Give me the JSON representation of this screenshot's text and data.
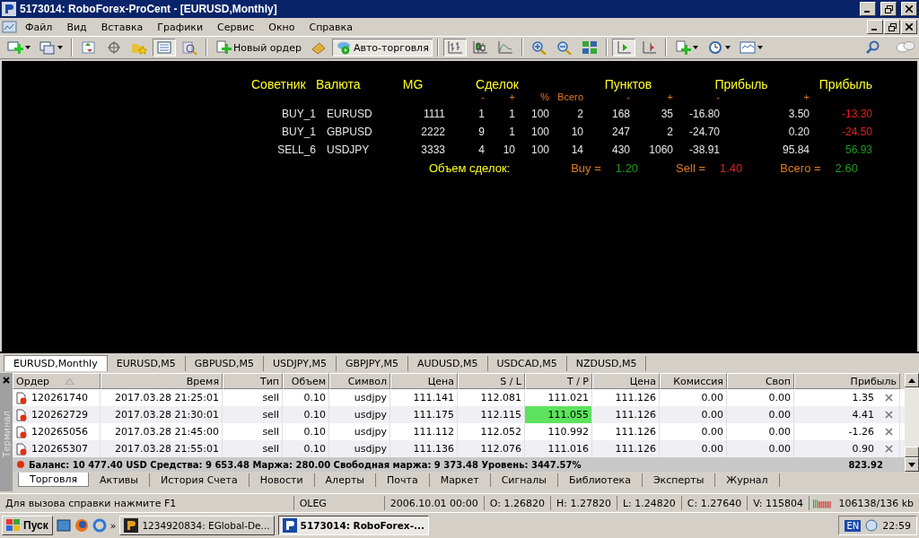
{
  "window": {
    "title": "5173014: RoboForex-ProCent - [EURUSD,Monthly]"
  },
  "menu": [
    "Файл",
    "Вид",
    "Вставка",
    "Графики",
    "Сервис",
    "Окно",
    "Справка"
  ],
  "toolbar": [
    {
      "selected": false
    },
    {
      "selected": false
    },
    {
      "selected": false
    },
    {
      "selected": false
    },
    {
      "selected": false
    },
    {
      "selected": true
    },
    {
      "selected": false
    },
    {
      "selected": false,
      "label": "Новый ордер"
    },
    {
      "selected": false
    },
    {
      "selected": true,
      "label": "Авто-торговля"
    },
    {
      "selected": true
    },
    {
      "selected": false
    },
    {
      "selected": false
    },
    {
      "selected": false
    },
    {
      "selected": false
    },
    {
      "selected": false
    },
    {
      "selected": true
    },
    {
      "selected": false
    },
    {
      "selected": false
    },
    {
      "selected": false
    },
    {
      "selected": false
    }
  ],
  "expert_panel": {
    "headers": [
      "Советник",
      "Валюта",
      "MG",
      "Сделок",
      "Пунктов",
      "Прибыль",
      "Прибыль"
    ],
    "subheaders": [
      "-",
      "+",
      "%",
      "Всего",
      "-",
      "+",
      "-",
      "+"
    ],
    "rows": [
      {
        "advisor": "BUY_1",
        "currency": "EURUSD",
        "mg": "1111",
        "deals_minus": "1",
        "deals_plus": "1",
        "deals_pct": "100",
        "deals_total": "2",
        "points_minus": "168",
        "points_plus": "35",
        "profit_minus": "-16.80",
        "profit_plus": "3.50",
        "profit": "-13.30",
        "color": "#e02020"
      },
      {
        "advisor": "BUY_1",
        "currency": "GBPUSD",
        "mg": "2222",
        "deals_minus": "9",
        "deals_plus": "1",
        "deals_pct": "100",
        "deals_total": "10",
        "points_minus": "247",
        "points_plus": "2",
        "profit_minus": "-24.70",
        "profit_plus": "0.20",
        "profit": "-24.50",
        "color": "#e02020"
      },
      {
        "advisor": "SELL_6",
        "currency": "USDJPY",
        "mg": "3333",
        "deals_minus": "4",
        "deals_plus": "10",
        "deals_pct": "100",
        "deals_total": "14",
        "points_minus": "430",
        "points_plus": "1060",
        "profit_minus": "-38.91",
        "profit_plus": "95.84",
        "profit": "56.93",
        "color": "#1f9a1f"
      }
    ],
    "summary": {
      "label": "Объем сделок:",
      "items": [
        {
          "label": "Buy =",
          "value": "1.20",
          "color": "#1f9a1f"
        },
        {
          "label": "Sell =",
          "value": "1.40",
          "color": "#e02020"
        },
        {
          "label": "Всего =",
          "value": "2.60",
          "color": "#1f9a1f"
        }
      ]
    }
  },
  "chart_tabs": [
    {
      "label": "EURUSD,Monthly",
      "selected": true
    },
    {
      "label": "EURUSD,M5",
      "selected": false
    },
    {
      "label": "GBPUSD,M5",
      "selected": false
    },
    {
      "label": "USDJPY,M5",
      "selected": false
    },
    {
      "label": "GBPJPY,M5",
      "selected": false
    },
    {
      "label": "AUDUSD,M5",
      "selected": false
    },
    {
      "label": "USDCAD,M5",
      "selected": false
    },
    {
      "label": "NZDUSD,M5",
      "selected": false
    }
  ],
  "terminal": {
    "label": "Терминал",
    "columns": [
      "Ордер",
      "Время",
      "Тип",
      "Объем",
      "Символ",
      "Цена",
      "S / L",
      "T / P",
      "Цена",
      "Комиссия",
      "Своп",
      "Прибыль"
    ],
    "rows": [
      {
        "order": "120261740",
        "time": "2017.03.28 21:25:01",
        "type": "sell",
        "volume": "0.10",
        "symbol": "usdjpy",
        "price": "111.141",
        "sl": "112.081",
        "tp": "111.021",
        "tp_hit": false,
        "current": "111.126",
        "commission": "0.00",
        "swap": "0.00",
        "profit": "1.35"
      },
      {
        "order": "120262729",
        "time": "2017.03.28 21:30:01",
        "type": "sell",
        "volume": "0.10",
        "symbol": "usdjpy",
        "price": "111.175",
        "sl": "112.115",
        "tp": "111.055",
        "tp_hit": true,
        "current": "111.126",
        "commission": "0.00",
        "swap": "0.00",
        "profit": "4.41"
      },
      {
        "order": "120265056",
        "time": "2017.03.28 21:45:00",
        "type": "sell",
        "volume": "0.10",
        "symbol": "usdjpy",
        "price": "111.112",
        "sl": "112.052",
        "tp": "110.992",
        "tp_hit": false,
        "current": "111.126",
        "commission": "0.00",
        "swap": "0.00",
        "profit": "-1.26"
      },
      {
        "order": "120265307",
        "time": "2017.03.28 21:55:01",
        "type": "sell",
        "volume": "0.10",
        "symbol": "usdjpy",
        "price": "111.136",
        "sl": "112.076",
        "tp": "111.016",
        "tp_hit": false,
        "current": "111.126",
        "commission": "0.00",
        "swap": "0.00",
        "profit": "0.90"
      }
    ],
    "balance": {
      "text": "Баланс: 10 477.40 USD  Средства: 9 653.48  Маржа: 280.00  Свободная маржа: 9 373.48  Уровень: 3447.57%",
      "profit": "823.92"
    },
    "tabs": [
      {
        "label": "Торговля",
        "selected": true
      },
      {
        "label": "Активы",
        "selected": false
      },
      {
        "label": "История Счета",
        "selected": false
      },
      {
        "label": "Новости",
        "selected": false
      },
      {
        "label": "Алерты",
        "selected": false
      },
      {
        "label": "Почта",
        "selected": false
      },
      {
        "label": "Маркет",
        "selected": false
      },
      {
        "label": "Сигналы",
        "selected": false
      },
      {
        "label": "Библиотека",
        "selected": false
      },
      {
        "label": "Эксперты",
        "selected": false
      },
      {
        "label": "Журнал",
        "selected": false
      }
    ]
  },
  "status_bar": {
    "help": "Для вызова справки нажмите F1",
    "profile": "OLEG",
    "date": "2006.10.01 00:00",
    "open": "O: 1.26820",
    "high": "H: 1.27820",
    "low": "L: 1.24820",
    "close": "C: 1.27640",
    "volume": "V: 115804",
    "traffic": "106138/136 kb"
  },
  "taskbar": {
    "start": "Пуск",
    "more": "»",
    "tasks": [
      {
        "label": "1234920834: EGlobal-De...",
        "selected": false
      },
      {
        "label": "5173014: RoboForex-...",
        "selected": true
      }
    ],
    "language": "EN",
    "clock": "22:59"
  }
}
